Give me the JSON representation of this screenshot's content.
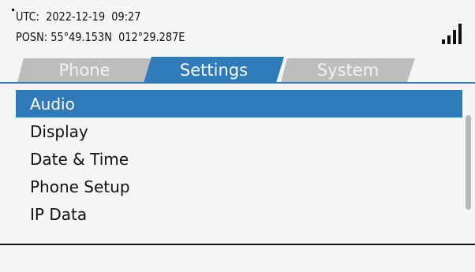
{
  "status": {
    "utc_line": "UTC:  2022-12-19  09:27",
    "posn_line": "POSN: 55°49.153N  012°29.287E",
    "signal_level": 4
  },
  "tabs": [
    {
      "label": "Phone",
      "active": false
    },
    {
      "label": "Settings",
      "active": true
    },
    {
      "label": "System",
      "active": false
    }
  ],
  "menu": {
    "items": [
      {
        "label": "Audio",
        "selected": true
      },
      {
        "label": "Display",
        "selected": false
      },
      {
        "label": "Date & Time",
        "selected": false
      },
      {
        "label": "Phone Setup",
        "selected": false
      },
      {
        "label": "IP Data",
        "selected": false
      }
    ]
  },
  "colors": {
    "accent": "#2f7ab8",
    "inactive_tab": "#bdbdbd",
    "background": "#f5f5f5"
  }
}
